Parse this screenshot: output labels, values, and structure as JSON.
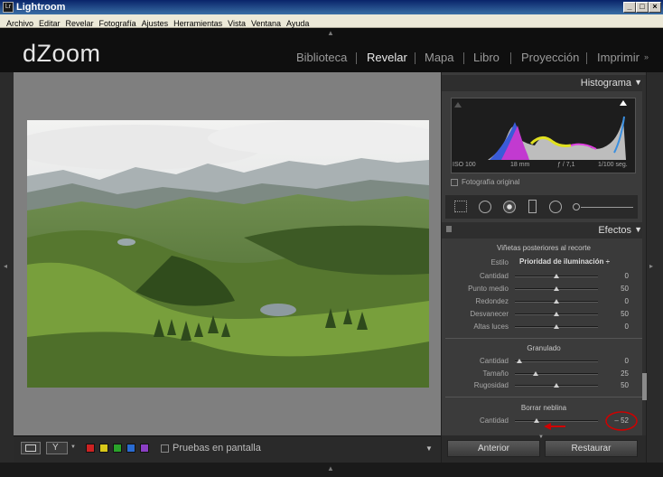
{
  "window": {
    "title": "Lightroom",
    "icon_text": "Lr"
  },
  "menu": [
    "Archivo",
    "Editar",
    "Revelar",
    "Fotografía",
    "Ajustes",
    "Herramientas",
    "Vista",
    "Ventana",
    "Ayuda"
  ],
  "app": {
    "name": "dZoom"
  },
  "modules": [
    {
      "label": "Biblioteca",
      "active": false
    },
    {
      "label": "Revelar",
      "active": true
    },
    {
      "label": "Mapa",
      "active": false
    },
    {
      "label": "Libro",
      "active": false
    },
    {
      "label": "Proyección",
      "active": false
    },
    {
      "label": "Imprimir",
      "active": false
    }
  ],
  "histogram": {
    "title": "Histograma",
    "iso": "ISO 100",
    "focal": "18 mm",
    "aperture": "ƒ / 7,1",
    "shutter": "1/100 seg.",
    "original_label": "Fotografía original"
  },
  "effects": {
    "title": "Efectos",
    "vignette": {
      "title": "Viñetas posteriores al recorte",
      "style_label": "Estilo",
      "style_value": "Prioridad de iluminación ÷",
      "rows": [
        {
          "label": "Cantidad",
          "value": "0",
          "pos": 0.5
        },
        {
          "label": "Punto medio",
          "value": "50",
          "pos": 0.5
        },
        {
          "label": "Redondez",
          "value": "0",
          "pos": 0.5
        },
        {
          "label": "Desvanecer",
          "value": "50",
          "pos": 0.5
        },
        {
          "label": "Altas luces",
          "value": "0",
          "pos": 0.5
        }
      ]
    },
    "grain": {
      "title": "Granulado",
      "rows": [
        {
          "label": "Cantidad",
          "value": "0",
          "pos": 0.05
        },
        {
          "label": "Tamaño",
          "value": "25",
          "pos": 0.25
        },
        {
          "label": "Rugosidad",
          "value": "50",
          "pos": 0.5
        }
      ]
    },
    "dehaze": {
      "title": "Borrar neblina",
      "rows": [
        {
          "label": "Cantidad",
          "value": "– 52",
          "pos": 0.26
        }
      ]
    }
  },
  "buttons": {
    "previous": "Anterior",
    "reset": "Restaurar"
  },
  "toolbar": {
    "softproof_label": "Pruebas en pantalla",
    "swatches": [
      "#cc2222",
      "#d8c81a",
      "#2aa32a",
      "#2a6bd1",
      "#8b3fc4"
    ]
  },
  "colors": {
    "annotation": "#d00000"
  }
}
